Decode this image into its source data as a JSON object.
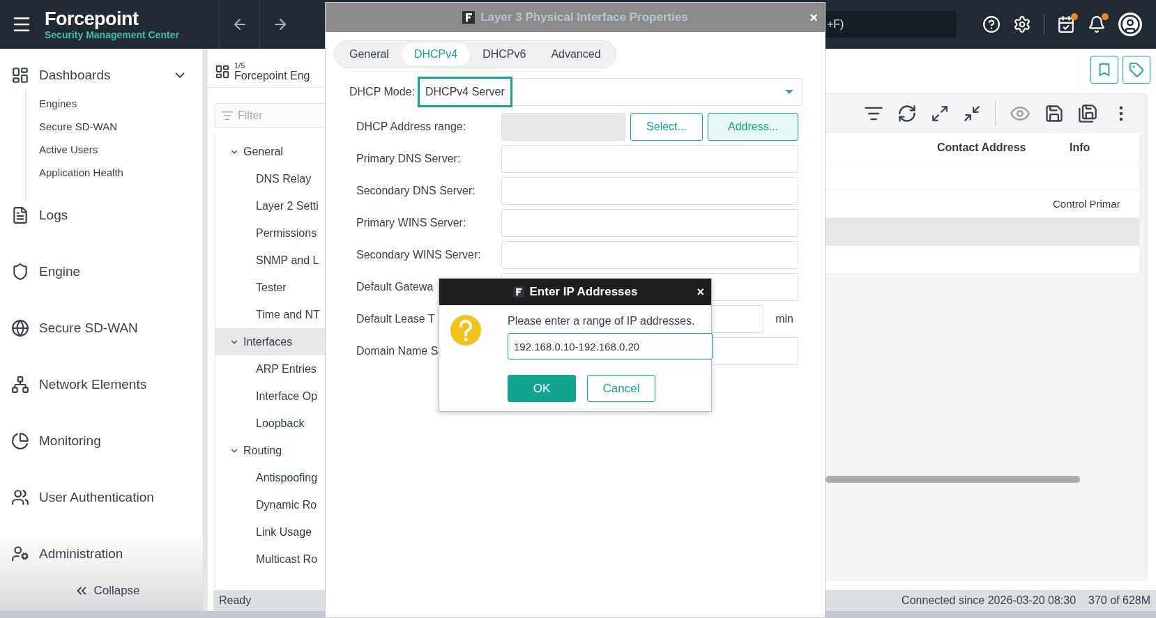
{
  "top_bar": {
    "logo": {
      "name": "Forcepoint",
      "subtitle": "Security Management Center"
    },
    "search": {
      "value": "+F)"
    },
    "calendar_badge": true,
    "bell_badge": true
  },
  "sidebar": {
    "items": [
      {
        "label": "Dashboards",
        "expanded": true,
        "children": [
          {
            "label": "Engines"
          },
          {
            "label": "Secure SD-WAN"
          },
          {
            "label": "Active Users"
          },
          {
            "label": "Application Health"
          }
        ]
      },
      {
        "label": "Logs"
      },
      {
        "label": "Engine"
      },
      {
        "label": "Secure SD-WAN"
      },
      {
        "label": "Network Elements"
      },
      {
        "label": "Monitoring"
      },
      {
        "label": "User Authentication"
      },
      {
        "label": "Administration"
      }
    ],
    "collapse": "Collapse"
  },
  "navigator": {
    "breadcrumb": {
      "position": "1/5",
      "title": "Forcepoint Eng"
    },
    "filter": {
      "placeholder": "Filter"
    },
    "tree": [
      {
        "label": "General",
        "expanded": true,
        "selected": false,
        "children": [
          {
            "label": "DNS Relay",
            "selected": false
          },
          {
            "label": "Layer 2 Setti",
            "selected": false
          },
          {
            "label": "Permissions",
            "selected": false
          },
          {
            "label": "SNMP and L",
            "selected": false
          },
          {
            "label": "Tester",
            "selected": false
          },
          {
            "label": "Time and NT",
            "selected": false
          }
        ]
      },
      {
        "label": "Interfaces",
        "expanded": true,
        "selected": true,
        "children": [
          {
            "label": "ARP Entries",
            "selected": false
          },
          {
            "label": "Interface Op",
            "selected": false
          },
          {
            "label": "Loopback",
            "selected": false
          }
        ]
      },
      {
        "label": "Routing",
        "expanded": true,
        "selected": false,
        "children": [
          {
            "label": "Antispoofing",
            "selected": false
          },
          {
            "label": "Dynamic Ro",
            "selected": false
          },
          {
            "label": "Link Usage",
            "selected": false
          },
          {
            "label": "Multicast Ro",
            "selected": false
          }
        ]
      }
    ],
    "status": "Ready"
  },
  "dialog": {
    "title": "Layer 3 Physical Interface Properties",
    "close": "×",
    "tabs": [
      {
        "label": "General",
        "selected": false
      },
      {
        "label": "DHCPv4",
        "selected": true
      },
      {
        "label": "DHCPv6",
        "selected": false
      },
      {
        "label": "Advanced",
        "selected": false
      }
    ],
    "mode": {
      "label": "DHCP Mode:",
      "value": "DHCPv4 Server",
      "highlighted": true
    },
    "fields": [
      {
        "kind": "range",
        "label": "DHCP Address range:",
        "disabled": true,
        "buttons": [
          "Select...",
          "Address..."
        ]
      },
      {
        "kind": "text",
        "label": "Primary DNS Server:"
      },
      {
        "kind": "text",
        "label": "Secondary DNS Server:"
      },
      {
        "kind": "text",
        "label": "Primary WINS Server:"
      },
      {
        "kind": "text",
        "label": "Secondary WINS Server:"
      },
      {
        "kind": "text",
        "label": "Default Gatewa"
      },
      {
        "kind": "unit",
        "label": "Default Lease T",
        "unit": "min"
      },
      {
        "kind": "text",
        "label": "Domain Name S"
      }
    ]
  },
  "modal": {
    "title": "Enter IP Addresses",
    "close": "×",
    "message": "Please enter a range of IP addresses.",
    "value": "192.168.0.10-192.168.0.20",
    "buttons": [
      {
        "label": "OK",
        "kind": "primary"
      },
      {
        "label": "Cancel",
        "kind": "secondary"
      }
    ]
  },
  "table": {
    "columns": [
      "Contact Address",
      "Info"
    ],
    "rows": [
      {
        "selected": false
      },
      {
        "info": "Control Primar",
        "selected": false
      },
      {
        "selected": true
      },
      {
        "selected": false
      }
    ]
  },
  "status_bar": {
    "connection": "Connected since 2026-03-20 08:30",
    "memory": "370 of 628M"
  }
}
